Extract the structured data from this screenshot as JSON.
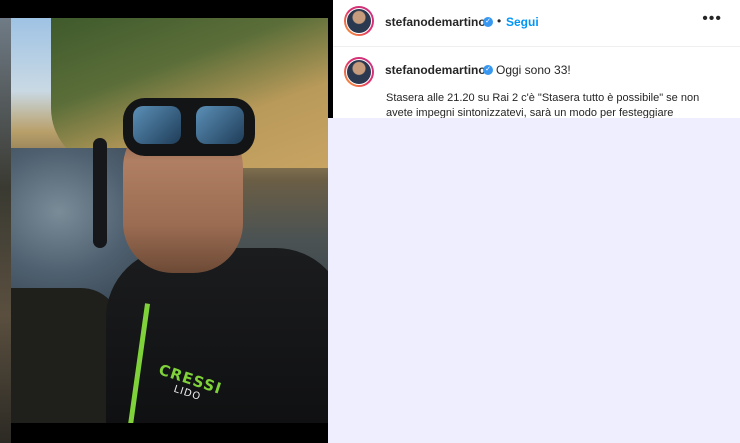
{
  "header": {
    "username": "stefanodemartino",
    "separator": "•",
    "follow_label": "Segui",
    "more_label": "•••"
  },
  "caption": {
    "username": "stefanodemartino",
    "title": "Oggi sono 33!",
    "text": "Stasera alle 21.20 su Rai 2 c'è \"Stasera tutto è possibile\" se non avete impegni sintonizzatevi, sarà un modo per festeggiare"
  },
  "photo": {
    "brand": "CRESSI",
    "brand_sub": "LIDO"
  },
  "colors": {
    "follow": "#0095f6",
    "verified": "#3897f0",
    "blank_area": "#eeeeff"
  },
  "icons": [
    "verified-badge-icon",
    "more-options-icon",
    "avatar-icon"
  ]
}
